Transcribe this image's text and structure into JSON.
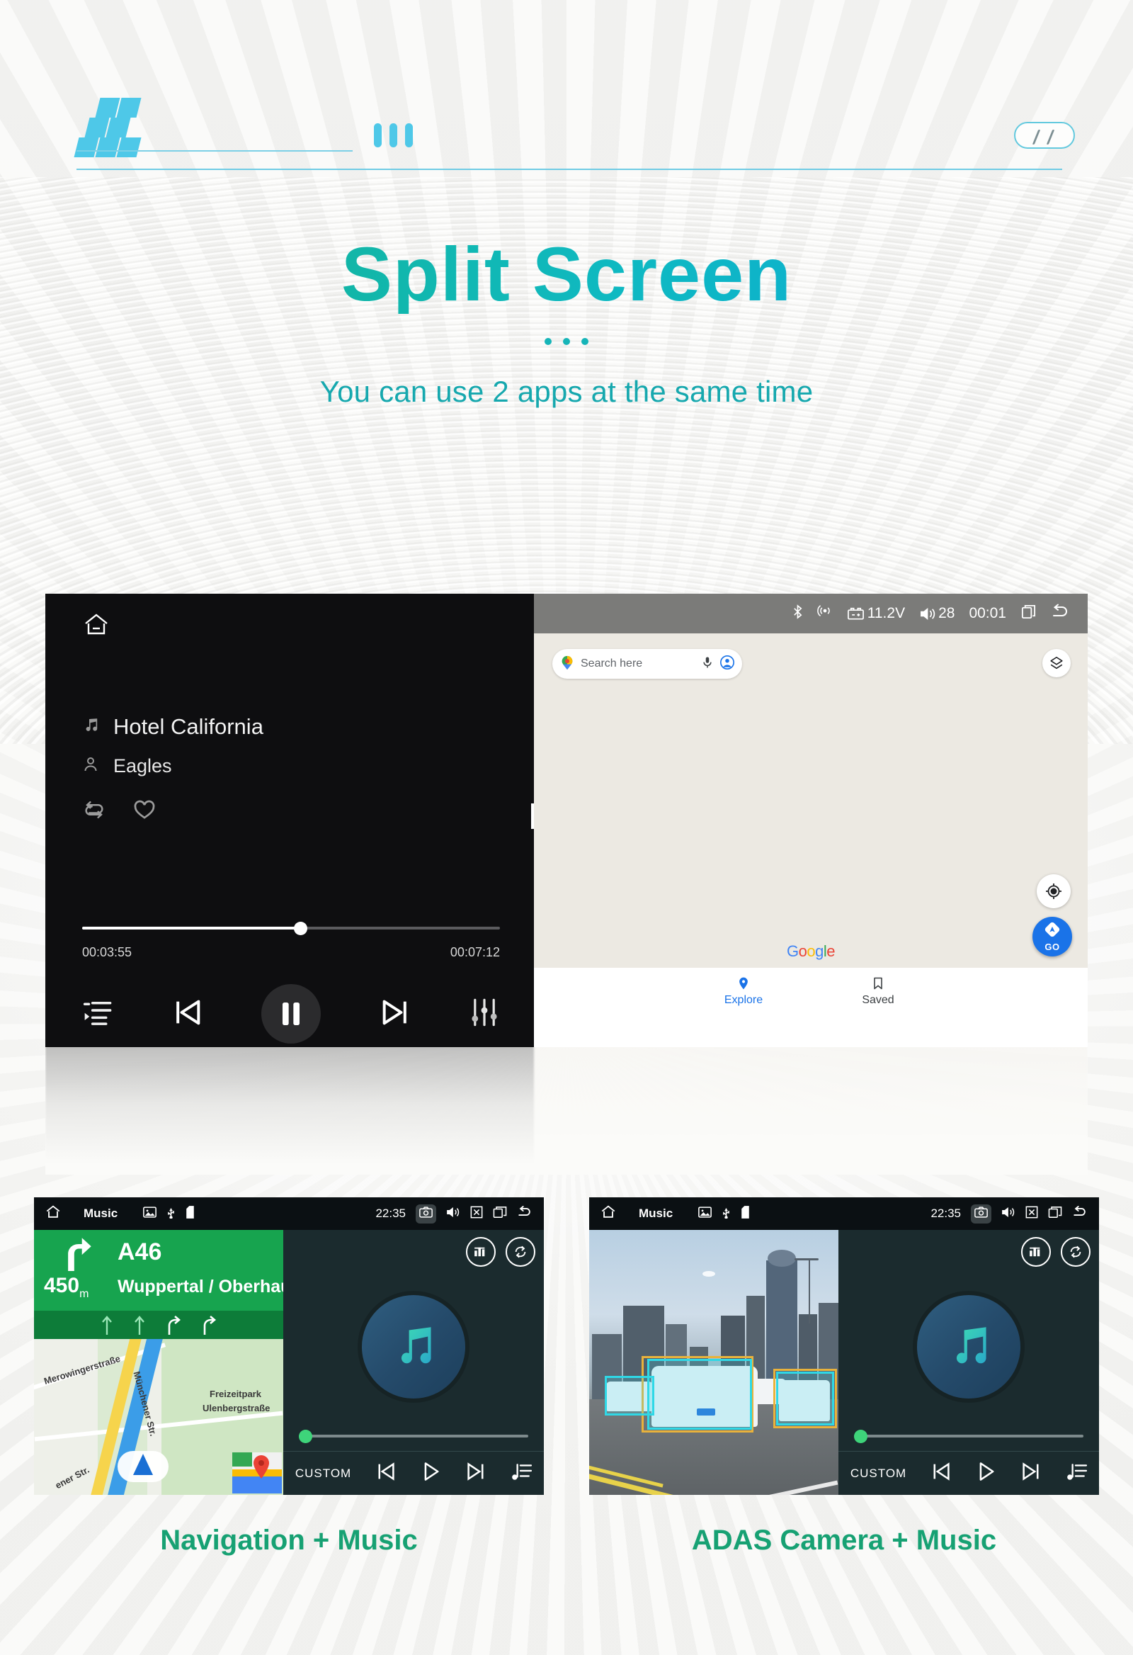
{
  "header": {
    "logo_name": "checkered-flag-logo",
    "bars_icon": "three-bars-icon",
    "pill_icon": "double-slash-pill-icon"
  },
  "hero": {
    "title": "Split Screen",
    "dots": "three-dots-separator",
    "subtitle": "You can use 2 apps at the same time"
  },
  "music_player": {
    "home_icon": "home-icon",
    "track_icon": "music-note-icon",
    "track_title": "Hotel California",
    "artist_icon": "person-icon",
    "artist": "Eagles",
    "repeat_icon": "repeat-icon",
    "favorite_icon": "heart-icon",
    "time_elapsed": "00:03:55",
    "time_total": "00:07:12",
    "progress_percent": 52,
    "controls": {
      "playlist_icon": "playlist-icon",
      "previous_icon": "previous-track-icon",
      "play_pause_icon": "pause-icon",
      "next_icon": "next-track-icon",
      "equalizer_icon": "equalizer-icon"
    }
  },
  "maps": {
    "status_bar": {
      "bluetooth_icon": "bluetooth-icon",
      "signal_icon": "wifi-signal-icon",
      "battery_icon": "car-battery-icon",
      "voltage": "11.2V",
      "volume_icon": "volume-icon",
      "volume": "28",
      "time": "00:01",
      "recents_icon": "recent-apps-icon",
      "back_icon": "back-arrow-icon"
    },
    "search": {
      "pin_icon": "google-maps-pin-icon",
      "placeholder": "Search here",
      "mic_icon": "microphone-icon",
      "account_icon": "account-circle-icon"
    },
    "layers_icon": "map-layers-icon",
    "locate_icon": "my-location-icon",
    "go_button": {
      "arrow_icon": "navigation-arrow-icon",
      "label": "GO"
    },
    "watermark": "Google",
    "tabs": [
      {
        "label": "Explore",
        "icon": "location-pin-icon",
        "active": true
      },
      {
        "label": "Saved",
        "icon": "bookmark-icon",
        "active": false
      }
    ]
  },
  "cards": [
    {
      "caption": "Navigation + Music",
      "status_bar": {
        "home_icon": "home-icon",
        "app_label": "Music",
        "image_icon": "image-icon",
        "usb_icon": "usb-icon",
        "sd_icon": "sd-card-icon",
        "time": "22:35",
        "camera_icon": "camera-icon",
        "volume_icon": "volume-icon",
        "mute_icon": "mute-x-icon",
        "recents_icon": "recent-apps-icon",
        "back_icon": "back-arrow-icon"
      },
      "left_app": "navigation",
      "navigation": {
        "turn_icon": "turn-right-arrow-icon",
        "road": "A46",
        "distance": "450",
        "distance_unit": "m",
        "destination": "Wuppertal / Oberhausen",
        "lane_icons": [
          "straight-arrow-icon",
          "straight-arrow-icon",
          "slight-right-arrow-icon",
          "right-arrow-icon"
        ],
        "map_labels": [
          "Merowingerstraße",
          "Münchener Str.",
          "Freizeitpark",
          "Ulenbergstraße",
          "ener Str."
        ],
        "position_marker_icon": "current-position-arrow-icon",
        "maps_badge_icon": "google-maps-badge-icon"
      },
      "music": {
        "equalizer_icon": "equalizer-circle-icon",
        "repeat_icon": "repeat-circle-icon",
        "album_icon": "music-note-icon",
        "progress_percent": 2,
        "source_label": "CUSTOM",
        "previous_icon": "previous-track-icon",
        "play_icon": "play-icon",
        "next_icon": "next-track-icon",
        "playlist_icon": "playlist-note-icon"
      }
    },
    {
      "caption": "ADAS Camera + Music",
      "status_bar": {
        "home_icon": "home-icon",
        "app_label": "Music",
        "image_icon": "image-icon",
        "usb_icon": "usb-icon",
        "sd_icon": "sd-card-icon",
        "time": "22:35",
        "camera_icon": "camera-icon",
        "volume_icon": "volume-icon",
        "mute_icon": "mute-x-icon",
        "recents_icon": "recent-apps-icon",
        "back_icon": "back-arrow-icon"
      },
      "left_app": "adas",
      "adas": {
        "description": "front-camera-view-with-vehicle-detection-boxes",
        "detections": 4
      },
      "music": {
        "equalizer_icon": "equalizer-circle-icon",
        "repeat_icon": "repeat-circle-icon",
        "album_icon": "music-note-icon",
        "progress_percent": 2,
        "source_label": "CUSTOM",
        "previous_icon": "previous-track-icon",
        "play_icon": "play-icon",
        "next_icon": "next-track-icon",
        "playlist_icon": "playlist-note-icon"
      }
    }
  ],
  "colors": {
    "accent_cyan": "#4ec8e8",
    "title_gradient_start": "#15b089",
    "title_gradient_end": "#0aa7da",
    "subtitle": "#16a8ae",
    "caption_green": "#17a173",
    "nav_green": "#17a44f",
    "maps_blue": "#1a73e8",
    "detect_cyan": "#2fd8e6"
  }
}
